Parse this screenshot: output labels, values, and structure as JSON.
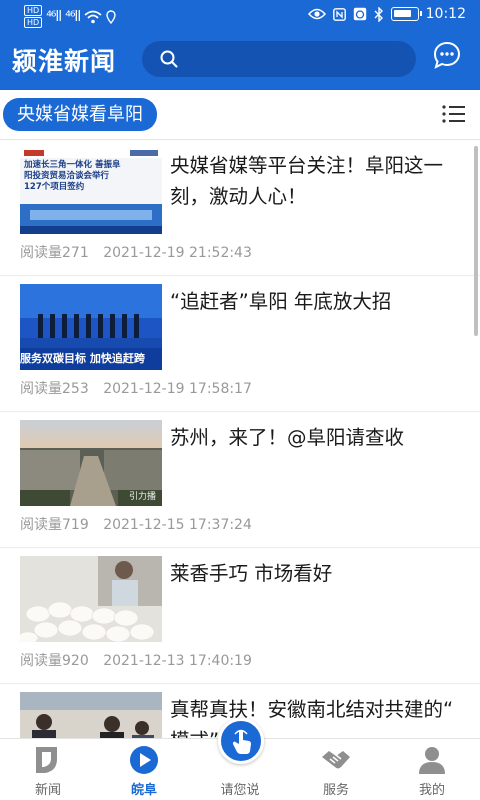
{
  "status_bar": {
    "sim1": "HD",
    "sim2": "HD",
    "network1": "⁴⁶ll",
    "network2": "⁴⁶ll",
    "time": "10:12"
  },
  "header": {
    "app_name": "颍淮新闻",
    "search_placeholder": ""
  },
  "channel": {
    "current": "央媒省媒看阜阳"
  },
  "articles": [
    {
      "title": "央媒省媒等平台关注！阜阳这一刻，激动人心！",
      "reads": "阅读量271",
      "date": "2021-12-19  21:52:43"
    },
    {
      "title": "“追赶者”阜阳 年底放大招",
      "reads": "阅读量253",
      "date": "2021-12-19  17:58:17"
    },
    {
      "title": "苏州，来了！@阜阳请查收",
      "reads": "阅读量719",
      "date": "2021-12-15  17:37:24"
    },
    {
      "title": "莱香手巧 市场看好",
      "reads": "阅读量920",
      "date": "2021-12-13  17:40:19"
    },
    {
      "title": "真帮真扶！安徽南北结对共建的“    模式”！",
      "reads": "",
      "date": ""
    }
  ],
  "thumb_text": {
    "a1_line1": "加速长三角一体化 善振阜",
    "a1_line2": "阳投资贸易洽谈会举行",
    "a1_line3": "127个项目签约",
    "a2_banner": "服务双碳目标  加快追赶跨",
    "a3_watermark": "引力播"
  },
  "bottom_nav": {
    "tabs": [
      {
        "label": "新闻",
        "icon": "news-icon"
      },
      {
        "label": "皖阜",
        "icon": "play-icon"
      },
      {
        "label": "请您说",
        "icon": "touch-icon"
      },
      {
        "label": "服务",
        "icon": "handshake-icon"
      },
      {
        "label": "我的",
        "icon": "user-icon"
      }
    ],
    "active": "皖阜"
  },
  "colors": {
    "brand_blue": "#1a69d4",
    "search_bg": "#1553b3",
    "meta_gray": "#999999"
  }
}
